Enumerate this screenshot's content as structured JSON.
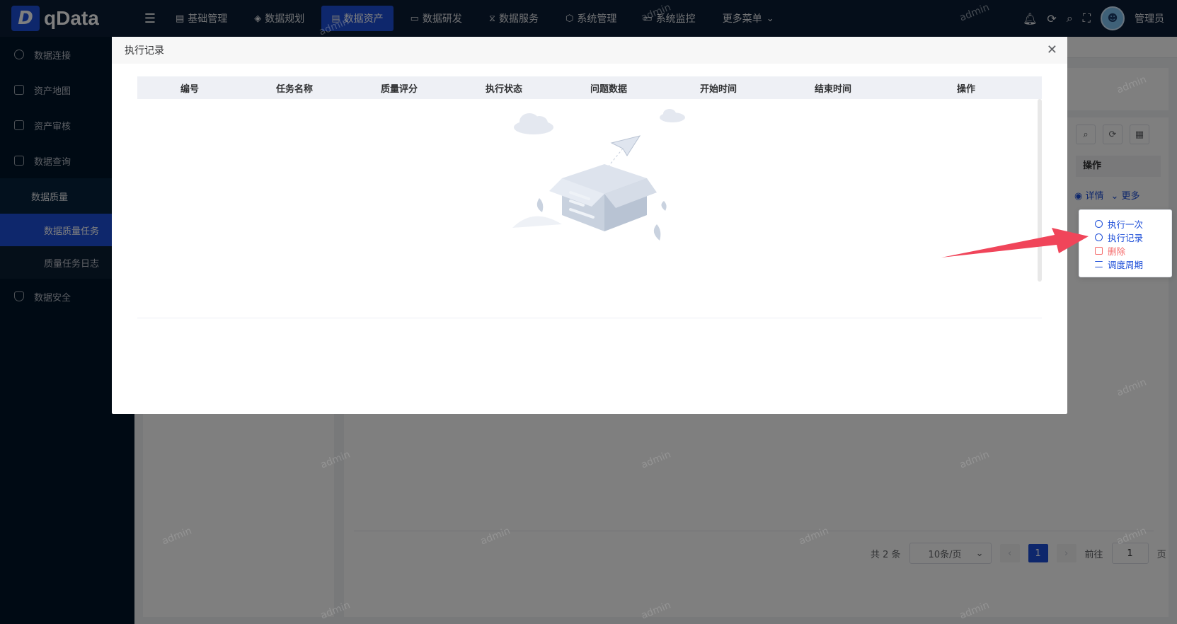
{
  "app": {
    "logo_mark": "D",
    "logo_text": "qData"
  },
  "sidebar": {
    "items": [
      {
        "label": "数据连接"
      },
      {
        "label": "资产地图"
      },
      {
        "label": "资产审核"
      },
      {
        "label": "数据查询"
      }
    ],
    "submenu_parent": "数据质量",
    "submenu": [
      {
        "label": "数据质量任务",
        "active": true
      },
      {
        "label": "质量任务日志",
        "active": false
      }
    ],
    "last_item": "数据安全"
  },
  "topnav": {
    "items": [
      {
        "label": "基础管理",
        "icon": "▤"
      },
      {
        "label": "数据规划",
        "icon": "◈"
      },
      {
        "label": "数据资产",
        "icon": "▤",
        "active": true
      },
      {
        "label": "数据研发",
        "icon": "▭"
      },
      {
        "label": "数据服务",
        "icon": "⧖"
      },
      {
        "label": "系统管理",
        "icon": "⬡"
      },
      {
        "label": "系统监控",
        "icon": "▭"
      },
      {
        "label": "更多菜单",
        "icon": "⌄"
      }
    ],
    "user_name": "管理员"
  },
  "background": {
    "op_header": "操作",
    "row_links": {
      "detail": "详情",
      "more": "更多"
    },
    "dropdown": [
      {
        "label": "执行一次",
        "kind": "normal"
      },
      {
        "label": "执行记录",
        "kind": "normal"
      },
      {
        "label": "删除",
        "kind": "danger"
      },
      {
        "label": "调度周期",
        "kind": "sliders"
      }
    ],
    "pagination": {
      "total": "共 2 条",
      "page_size": "10条/页",
      "current_page": "1",
      "goto_label": "前往",
      "goto_value": "1",
      "page_suffix": "页"
    }
  },
  "watermark": "admin",
  "modal": {
    "title": "执行记录",
    "columns": [
      "编号",
      "任务名称",
      "质量评分",
      "执行状态",
      "问题数据",
      "开始时间",
      "结束时间",
      "操作"
    ],
    "rows": []
  },
  "colors": {
    "primary": "#1d4ed8",
    "sidebar_bg": "#001529",
    "danger": "#f56c6c",
    "arrow": "#f0455a"
  }
}
